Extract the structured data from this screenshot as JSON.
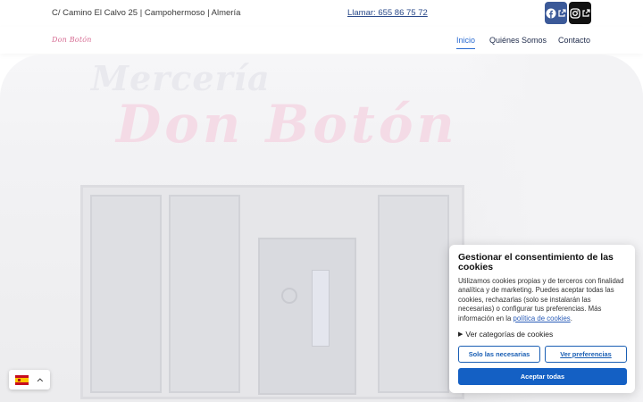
{
  "topbar": {
    "address": "C/ Camino El Calvo 25 | Campohermoso | Almería",
    "phone_icon": "phone-icon",
    "phone_label": " Llamar: 655 86 75 72",
    "social": [
      {
        "name": "facebook",
        "icon": "facebook-icon",
        "color": "#3b5998"
      },
      {
        "name": "instagram",
        "icon": "instagram-icon",
        "color": "#111111"
      }
    ]
  },
  "nav": {
    "logo": "Don Botón",
    "items": [
      {
        "label": "Inicio",
        "active": true
      },
      {
        "label": "Quiénes Somos",
        "active": false
      },
      {
        "label": "Contacto",
        "active": false
      }
    ]
  },
  "hero": {
    "sign_line1": "Mercería",
    "sign_line2": "Don Botón"
  },
  "cookie": {
    "title": "Gestionar el consentimiento de las cookies",
    "body": "Utilizamos cookies propias y de terceros con finalidad analítica y de marketing. Puedes aceptar todas las cookies, rechazarlas (solo se instalarán las necesarias) o configurar tus preferencias. Más información en la ",
    "policy_link": "política de cookies",
    "body_end": ".",
    "categories_label": "Ver categorías de cookies",
    "btn_necessary": "Solo las necesarias",
    "btn_preferences": "Ver preferencias",
    "btn_accept": "Aceptar todas",
    "accent": "#1460c4"
  },
  "language": {
    "flag": "spain-flag-icon",
    "caret": "^"
  }
}
